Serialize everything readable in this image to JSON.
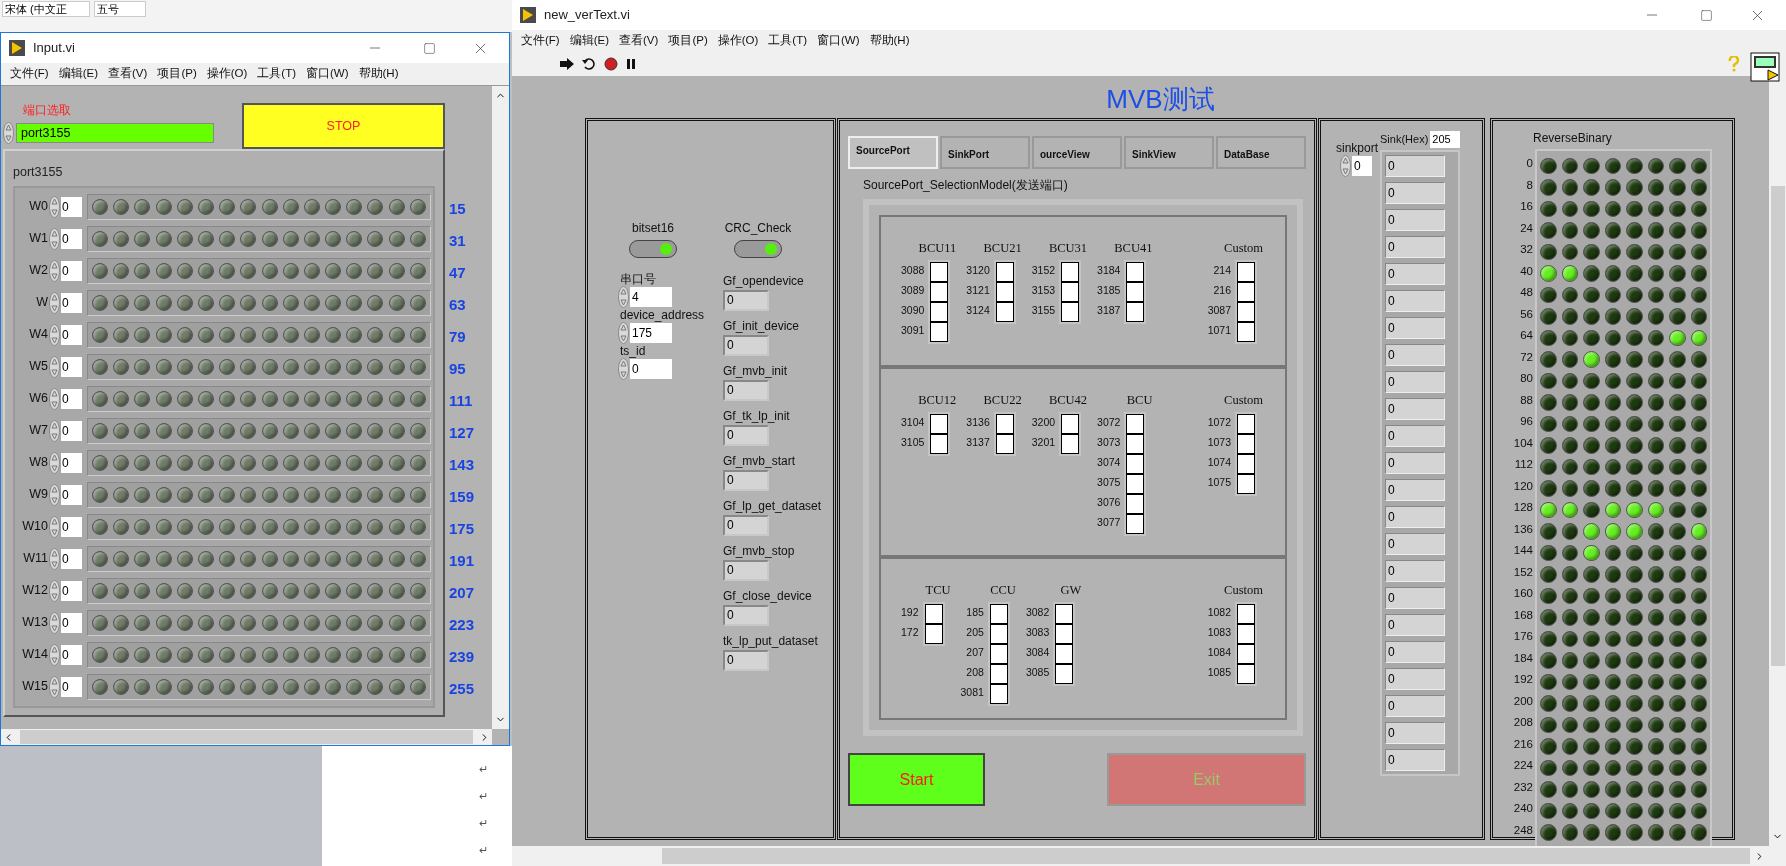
{
  "word": {
    "font_box": "宋体 (中文正",
    "size_box": "五号",
    "marks": [
      "↵",
      "↵",
      "↵",
      "↵"
    ]
  },
  "input_window": {
    "title": "Input.vi",
    "menu": [
      "文件(F)",
      "编辑(E)",
      "查看(V)",
      "项目(P)",
      "操作(O)",
      "工具(T)",
      "窗口(W)",
      "帮助(H)"
    ],
    "port_label": "端口选取",
    "port_value": "port3155",
    "stop_button": "STOP",
    "cluster_label": "port3155",
    "rows": [
      {
        "name": "W0",
        "value": "0",
        "weight": "15",
        "leds_on": [
          false,
          false,
          false,
          false,
          false,
          false,
          false,
          false,
          false,
          false,
          false,
          false,
          false,
          false,
          false,
          false
        ]
      },
      {
        "name": "W1",
        "value": "0",
        "weight": "31",
        "leds_on": [
          false,
          false,
          false,
          false,
          false,
          false,
          false,
          false,
          false,
          false,
          false,
          false,
          false,
          false,
          false,
          false
        ]
      },
      {
        "name": "W2",
        "value": "0",
        "weight": "47",
        "leds_on": [
          false,
          false,
          false,
          false,
          false,
          false,
          false,
          false,
          false,
          false,
          false,
          false,
          false,
          false,
          false,
          false
        ]
      },
      {
        "name": "W",
        "value": "0",
        "weight": "63",
        "leds_on": [
          false,
          false,
          false,
          false,
          false,
          false,
          false,
          false,
          false,
          false,
          false,
          false,
          false,
          false,
          false,
          false
        ]
      },
      {
        "name": "W4",
        "value": "0",
        "weight": "79",
        "leds_on": [
          false,
          false,
          false,
          false,
          false,
          false,
          false,
          false,
          false,
          false,
          false,
          false,
          false,
          false,
          false,
          false
        ]
      },
      {
        "name": "W5",
        "value": "0",
        "weight": "95",
        "leds_on": [
          false,
          false,
          false,
          false,
          false,
          false,
          false,
          false,
          false,
          false,
          false,
          false,
          false,
          false,
          false,
          false
        ]
      },
      {
        "name": "W6",
        "value": "0",
        "weight": "111",
        "leds_on": [
          false,
          false,
          false,
          false,
          false,
          false,
          false,
          false,
          false,
          false,
          false,
          false,
          false,
          false,
          false,
          false
        ]
      },
      {
        "name": "W7",
        "value": "0",
        "weight": "127",
        "leds_on": [
          false,
          false,
          false,
          false,
          false,
          false,
          false,
          false,
          false,
          false,
          false,
          false,
          false,
          false,
          false,
          false
        ]
      },
      {
        "name": "W8",
        "value": "0",
        "weight": "143",
        "leds_on": [
          false,
          false,
          false,
          false,
          false,
          false,
          false,
          false,
          false,
          false,
          false,
          false,
          false,
          false,
          false,
          false
        ]
      },
      {
        "name": "W9",
        "value": "0",
        "weight": "159",
        "leds_on": [
          false,
          false,
          false,
          false,
          false,
          false,
          false,
          false,
          false,
          false,
          false,
          false,
          false,
          false,
          false,
          false
        ]
      },
      {
        "name": "W10",
        "value": "0",
        "weight": "175",
        "leds_on": [
          false,
          false,
          false,
          false,
          false,
          false,
          false,
          false,
          false,
          false,
          false,
          false,
          false,
          false,
          false,
          false
        ]
      },
      {
        "name": "W11",
        "value": "0",
        "weight": "191",
        "leds_on": [
          false,
          false,
          false,
          false,
          false,
          false,
          false,
          false,
          false,
          false,
          false,
          false,
          false,
          false,
          false,
          false
        ]
      },
      {
        "name": "W12",
        "value": "0",
        "weight": "207",
        "leds_on": [
          false,
          false,
          false,
          false,
          false,
          false,
          false,
          false,
          false,
          false,
          false,
          false,
          false,
          false,
          false,
          false
        ]
      },
      {
        "name": "W13",
        "value": "0",
        "weight": "223",
        "leds_on": [
          false,
          false,
          false,
          false,
          false,
          false,
          false,
          false,
          false,
          false,
          false,
          false,
          false,
          false,
          false,
          false
        ]
      },
      {
        "name": "W14",
        "value": "0",
        "weight": "239",
        "leds_on": [
          false,
          false,
          false,
          false,
          false,
          false,
          false,
          false,
          false,
          false,
          false,
          false,
          false,
          false,
          false,
          false
        ]
      },
      {
        "name": "W15",
        "value": "0",
        "weight": "255",
        "leds_on": [
          false,
          false,
          false,
          false,
          false,
          false,
          false,
          false,
          false,
          false,
          false,
          false,
          false,
          false,
          false,
          false
        ]
      }
    ]
  },
  "main_window": {
    "title": "new_verText.vi",
    "menu": [
      "文件(F)",
      "编辑(E)",
      "查看(V)",
      "项目(P)",
      "操作(O)",
      "工具(T)",
      "窗口(W)",
      "帮助(H)"
    ],
    "heading": "MVB测试",
    "toggles": [
      {
        "label": "bitset16",
        "on": true
      },
      {
        "label": "CRC_Check",
        "on": true
      }
    ],
    "controls": [
      {
        "label": "串口号",
        "value": "4"
      },
      {
        "label": "device_address",
        "value": "175"
      },
      {
        "label": "ts_id",
        "value": "0"
      }
    ],
    "indicators": [
      {
        "label": "Gf_opendevice",
        "value": "0"
      },
      {
        "label": "Gf_init_device",
        "value": "0"
      },
      {
        "label": "Gf_mvb_init",
        "value": "0"
      },
      {
        "label": "Gf_tk_lp_init",
        "value": "0"
      },
      {
        "label": "Gf_mvb_start",
        "value": "0"
      },
      {
        "label": "Gf_lp_get_dataset",
        "value": "0"
      },
      {
        "label": "Gf_mvb_stop",
        "value": "0"
      },
      {
        "label": "Gf_close_device",
        "value": "0"
      },
      {
        "label": "tk_lp_put_dataset",
        "value": "0"
      }
    ],
    "tabs": [
      {
        "label": "SourcePort",
        "selected": true
      },
      {
        "label": "SinkPort",
        "selected": false
      },
      {
        "label": "ourceView",
        "selected": false
      },
      {
        "label": "SinkView",
        "selected": false
      },
      {
        "label": "DataBase",
        "selected": false
      }
    ],
    "selection_label": "SourcePort_SelectionModel(发送端口)",
    "groups": [
      {
        "columns": [
          {
            "title": "BCU11",
            "ports": [
              {
                "label": "3088",
                "checked": false
              },
              {
                "label": "3089",
                "checked": false
              },
              {
                "label": "3090",
                "checked": false
              },
              {
                "label": "3091",
                "checked": false
              }
            ]
          },
          {
            "title": "BCU21",
            "ports": [
              {
                "label": "3120",
                "checked": false
              },
              {
                "label": "3121",
                "checked": false
              },
              {
                "label": "3124",
                "checked": false
              }
            ]
          },
          {
            "title": "BCU31",
            "ports": [
              {
                "label": "3152",
                "checked": false
              },
              {
                "label": "3153",
                "checked": false
              },
              {
                "label": "3155",
                "checked": false
              }
            ]
          },
          {
            "title": "BCU41",
            "ports": [
              {
                "label": "3184",
                "checked": false
              },
              {
                "label": "3185",
                "checked": false
              },
              {
                "label": "3187",
                "checked": false
              }
            ]
          },
          {
            "title": "Custom",
            "ports": [
              {
                "label": "214",
                "checked": false
              },
              {
                "label": "216",
                "checked": false
              },
              {
                "label": "3087",
                "checked": false
              },
              {
                "label": "1071",
                "checked": false
              }
            ]
          }
        ]
      },
      {
        "columns": [
          {
            "title": "BCU12",
            "ports": [
              {
                "label": "3104",
                "checked": false
              },
              {
                "label": "3105",
                "checked": false
              }
            ]
          },
          {
            "title": "BCU22",
            "ports": [
              {
                "label": "3136",
                "checked": false
              },
              {
                "label": "3137",
                "checked": false
              }
            ]
          },
          {
            "title": "BCU42",
            "ports": [
              {
                "label": "3200",
                "checked": false
              },
              {
                "label": "3201",
                "checked": false
              }
            ]
          },
          {
            "title": "BCU",
            "ports": [
              {
                "label": "3072",
                "checked": false
              },
              {
                "label": "3073",
                "checked": false
              },
              {
                "label": "3074",
                "checked": false
              },
              {
                "label": "3075",
                "checked": false
              },
              {
                "label": "3076",
                "checked": false
              },
              {
                "label": "3077",
                "checked": false
              }
            ]
          },
          {
            "title": "Custom",
            "ports": [
              {
                "label": "1072",
                "checked": false
              },
              {
                "label": "1073",
                "checked": false
              },
              {
                "label": "1074",
                "checked": false
              },
              {
                "label": "1075",
                "checked": false
              }
            ]
          }
        ]
      },
      {
        "columns": [
          {
            "title": "TCU",
            "ports": [
              {
                "label": "192",
                "checked": false
              },
              {
                "label": "172",
                "checked": false
              }
            ]
          },
          {
            "title": "CCU",
            "ports": [
              {
                "label": "185",
                "checked": false
              },
              {
                "label": "205",
                "checked": false
              },
              {
                "label": "207",
                "checked": false
              },
              {
                "label": "208",
                "checked": false
              },
              {
                "label": "3081",
                "checked": false
              }
            ]
          },
          {
            "title": "GW",
            "ports": [
              {
                "label": "3082",
                "checked": false
              },
              {
                "label": "3083",
                "checked": false
              },
              {
                "label": "3084",
                "checked": false
              },
              {
                "label": "3085",
                "checked": false
              }
            ]
          },
          {
            "title": "Custom",
            "ports": [
              {
                "label": "1082",
                "checked": false
              },
              {
                "label": "1083",
                "checked": false
              },
              {
                "label": "1084",
                "checked": false
              },
              {
                "label": "1085",
                "checked": false
              }
            ]
          }
        ]
      }
    ],
    "start_button": "Start",
    "exit_button": "Exit",
    "sink": {
      "port_label": "sinkport",
      "port_value": "0",
      "hex_label": "Sink(Hex)",
      "hex_value": "205",
      "values": [
        "0",
        "0",
        "0",
        "0",
        "0",
        "0",
        "0",
        "0",
        "0",
        "0",
        "0",
        "0",
        "0",
        "0",
        "0",
        "0",
        "0",
        "0",
        "0",
        "0",
        "0",
        "0",
        "0"
      ]
    },
    "reverse_binary": {
      "label": "ReverseBinary",
      "rows": [
        {
          "label": "0",
          "leds_on": [
            false,
            false,
            false,
            false,
            false,
            false,
            false,
            false
          ]
        },
        {
          "label": "8",
          "leds_on": [
            false,
            false,
            false,
            false,
            false,
            false,
            false,
            false
          ]
        },
        {
          "label": "16",
          "leds_on": [
            false,
            false,
            false,
            false,
            false,
            false,
            false,
            false
          ]
        },
        {
          "label": "24",
          "leds_on": [
            false,
            false,
            false,
            false,
            false,
            false,
            false,
            false
          ]
        },
        {
          "label": "32",
          "leds_on": [
            false,
            false,
            false,
            false,
            false,
            false,
            false,
            false
          ]
        },
        {
          "label": "40",
          "leds_on": [
            true,
            true,
            false,
            false,
            false,
            false,
            false,
            false
          ]
        },
        {
          "label": "48",
          "leds_on": [
            false,
            false,
            false,
            false,
            false,
            false,
            false,
            false
          ]
        },
        {
          "label": "56",
          "leds_on": [
            false,
            false,
            false,
            false,
            false,
            false,
            false,
            false
          ]
        },
        {
          "label": "64",
          "leds_on": [
            false,
            false,
            false,
            false,
            false,
            false,
            true,
            true
          ]
        },
        {
          "label": "72",
          "leds_on": [
            false,
            false,
            true,
            false,
            false,
            false,
            false,
            false
          ]
        },
        {
          "label": "80",
          "leds_on": [
            false,
            false,
            false,
            false,
            false,
            false,
            false,
            false
          ]
        },
        {
          "label": "88",
          "leds_on": [
            false,
            false,
            false,
            false,
            false,
            false,
            false,
            false
          ]
        },
        {
          "label": "96",
          "leds_on": [
            false,
            false,
            false,
            false,
            false,
            false,
            false,
            false
          ]
        },
        {
          "label": "104",
          "leds_on": [
            false,
            false,
            false,
            false,
            false,
            false,
            false,
            false
          ]
        },
        {
          "label": "112",
          "leds_on": [
            false,
            false,
            false,
            false,
            false,
            false,
            false,
            false
          ]
        },
        {
          "label": "120",
          "leds_on": [
            false,
            false,
            false,
            false,
            false,
            false,
            false,
            false
          ]
        },
        {
          "label": "128",
          "leds_on": [
            true,
            true,
            false,
            true,
            true,
            true,
            false,
            false
          ]
        },
        {
          "label": "136",
          "leds_on": [
            false,
            false,
            true,
            true,
            true,
            false,
            false,
            true
          ]
        },
        {
          "label": "144",
          "leds_on": [
            false,
            false,
            true,
            false,
            false,
            false,
            false,
            false
          ]
        },
        {
          "label": "152",
          "leds_on": [
            false,
            false,
            false,
            false,
            false,
            false,
            false,
            false
          ]
        },
        {
          "label": "160",
          "leds_on": [
            false,
            false,
            false,
            false,
            false,
            false,
            false,
            false
          ]
        },
        {
          "label": "168",
          "leds_on": [
            false,
            false,
            false,
            false,
            false,
            false,
            false,
            false
          ]
        },
        {
          "label": "176",
          "leds_on": [
            false,
            false,
            false,
            false,
            false,
            false,
            false,
            false
          ]
        },
        {
          "label": "184",
          "leds_on": [
            false,
            false,
            false,
            false,
            false,
            false,
            false,
            false
          ]
        },
        {
          "label": "192",
          "leds_on": [
            false,
            false,
            false,
            false,
            false,
            false,
            false,
            false
          ]
        },
        {
          "label": "200",
          "leds_on": [
            false,
            false,
            false,
            false,
            false,
            false,
            false,
            false
          ]
        },
        {
          "label": "208",
          "leds_on": [
            false,
            false,
            false,
            false,
            false,
            false,
            false,
            false
          ]
        },
        {
          "label": "216",
          "leds_on": [
            false,
            false,
            false,
            false,
            false,
            false,
            false,
            false
          ]
        },
        {
          "label": "224",
          "leds_on": [
            false,
            false,
            false,
            false,
            false,
            false,
            false,
            false
          ]
        },
        {
          "label": "232",
          "leds_on": [
            false,
            false,
            false,
            false,
            false,
            false,
            false,
            false
          ]
        },
        {
          "label": "240",
          "leds_on": [
            false,
            false,
            false,
            false,
            false,
            false,
            false,
            false
          ]
        },
        {
          "label": "248",
          "leds_on": [
            false,
            false,
            false,
            false,
            false,
            false,
            false,
            false
          ]
        }
      ]
    }
  }
}
